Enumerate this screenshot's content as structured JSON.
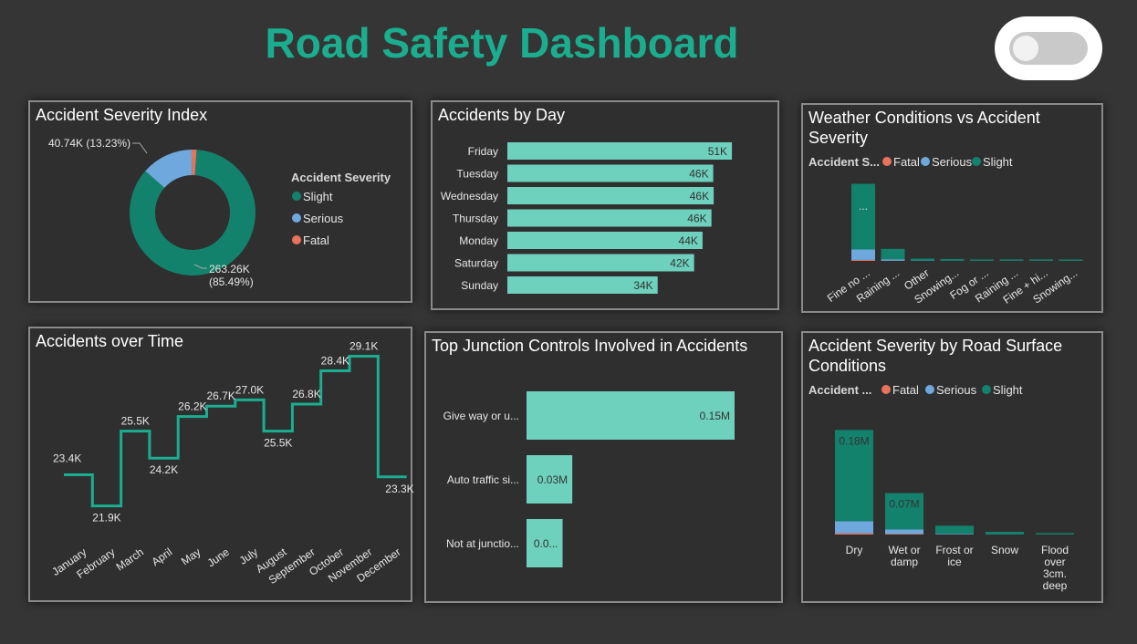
{
  "dashboard": {
    "title": "Road Safety Dashboard",
    "toggle": {
      "state": "off"
    }
  },
  "colors": {
    "slight": "#13826c",
    "serious": "#6fa8dc",
    "fatal": "#e8735a",
    "bar": "#6ed1bd",
    "line": "#1aae8e",
    "title": "#1aae8e"
  },
  "chart_data": [
    {
      "id": "severity",
      "type": "pie",
      "title": "Accident Severity Index",
      "legend_title": "Accident Severity",
      "legend_position": "right",
      "slices": [
        {
          "name": "Slight",
          "value": 263.26,
          "label_line1": "263.26K",
          "label_line2": "(85.49%)"
        },
        {
          "name": "Serious",
          "value": 40.74,
          "label_line1": "40.74K (13.23%)",
          "label_line2": ""
        },
        {
          "name": "Fatal",
          "value": 3.98,
          "label_line1": "",
          "label_line2": ""
        }
      ]
    },
    {
      "id": "day",
      "type": "bar",
      "orientation": "horizontal",
      "title": "Accidents by Day",
      "categories": [
        "Friday",
        "Tuesday",
        "Wednesday",
        "Thursday",
        "Monday",
        "Saturday",
        "Sunday"
      ],
      "values": [
        50.5,
        46.3,
        46.4,
        45.9,
        43.9,
        42.0,
        33.8
      ],
      "data_labels": [
        "51K",
        "46K",
        "46K",
        "46K",
        "44K",
        "42K",
        "34K"
      ],
      "xlim": [
        0,
        55
      ]
    },
    {
      "id": "weather",
      "type": "bar",
      "stacked": true,
      "title_line1": "Weather Conditions vs Accident",
      "title_line2": "Severity",
      "legend_title": "Accident S...",
      "legend_position": "top-left",
      "categories": [
        "Fine no ...",
        "Raining ...",
        "Other",
        "Snowing...",
        "Fog or ...",
        "Raining ...",
        "Fine + hi...",
        "Snowing..."
      ],
      "series": [
        {
          "name": "Fatal",
          "values": [
            3.1,
            0.4,
            0.1,
            0.05,
            0.05,
            0.05,
            0.05,
            0.02
          ]
        },
        {
          "name": "Serious",
          "values": [
            33.0,
            4.7,
            0.9,
            0.4,
            0.2,
            0.4,
            0.4,
            0.1
          ]
        },
        {
          "name": "Slight",
          "values": [
            208.0,
            33.0,
            6.2,
            5.5,
            1.2,
            3.5,
            3.5,
            1.3
          ]
        }
      ],
      "ylim": [
        0,
        260
      ],
      "data_labels": [
        "...",
        "",
        "",
        "",
        "",
        "",
        "",
        ""
      ]
    },
    {
      "id": "time",
      "type": "line",
      "step": true,
      "title": "Accidents over Time",
      "categories": [
        "January",
        "February",
        "March",
        "April",
        "May",
        "June",
        "July",
        "August",
        "September",
        "October",
        "November",
        "December"
      ],
      "values": [
        23.4,
        21.9,
        25.5,
        24.2,
        26.2,
        26.7,
        27.0,
        25.5,
        26.8,
        28.4,
        29.1,
        23.3
      ],
      "data_labels": [
        "23.4K",
        "21.9K",
        "25.5K",
        "24.2K",
        "26.2K",
        "26.7K",
        "27.0K",
        "25.5K",
        "26.8K",
        "28.4K",
        "29.1K",
        "23.3K"
      ],
      "label_pos": [
        "above",
        "below",
        "above",
        "below",
        "above",
        "above",
        "above",
        "below",
        "above",
        "above",
        "above",
        "below"
      ],
      "ylim": [
        20,
        30
      ]
    },
    {
      "id": "junction",
      "type": "bar",
      "orientation": "horizontal",
      "title": "Top Junction Controls Involved in Accidents",
      "categories": [
        "Give way or u...",
        "Auto traffic si...",
        "Not at junctio..."
      ],
      "values": [
        0.15,
        0.033,
        0.026
      ],
      "data_labels": [
        "0.15M",
        "0.03M",
        "0.0..."
      ],
      "xlim": [
        0,
        0.15
      ]
    },
    {
      "id": "surface",
      "type": "bar",
      "stacked": true,
      "title_line1": "Accident Severity by Road Surface",
      "title_line2": "Conditions",
      "legend_title": "Accident ...",
      "legend_position": "top-left",
      "categories": [
        [
          "Dry"
        ],
        [
          "Wet or",
          "damp"
        ],
        [
          "Frost or",
          "ice"
        ],
        [
          "Snow"
        ],
        [
          "Flood",
          "over",
          "3cm.",
          "deep"
        ]
      ],
      "series": [
        {
          "name": "Fatal",
          "values": [
            2.5,
            1.2,
            0.2,
            0.05,
            0.01
          ]
        },
        {
          "name": "Serious",
          "values": [
            24.0,
            9.0,
            1.3,
            0.4,
            0.06
          ]
        },
        {
          "name": "Slight",
          "values": [
            181.0,
            72.0,
            16.0,
            5.0,
            0.9
          ]
        }
      ],
      "data_labels": [
        "0.18M",
        "0.07M",
        "",
        "",
        ""
      ],
      "ylim": [
        0,
        210
      ]
    }
  ]
}
